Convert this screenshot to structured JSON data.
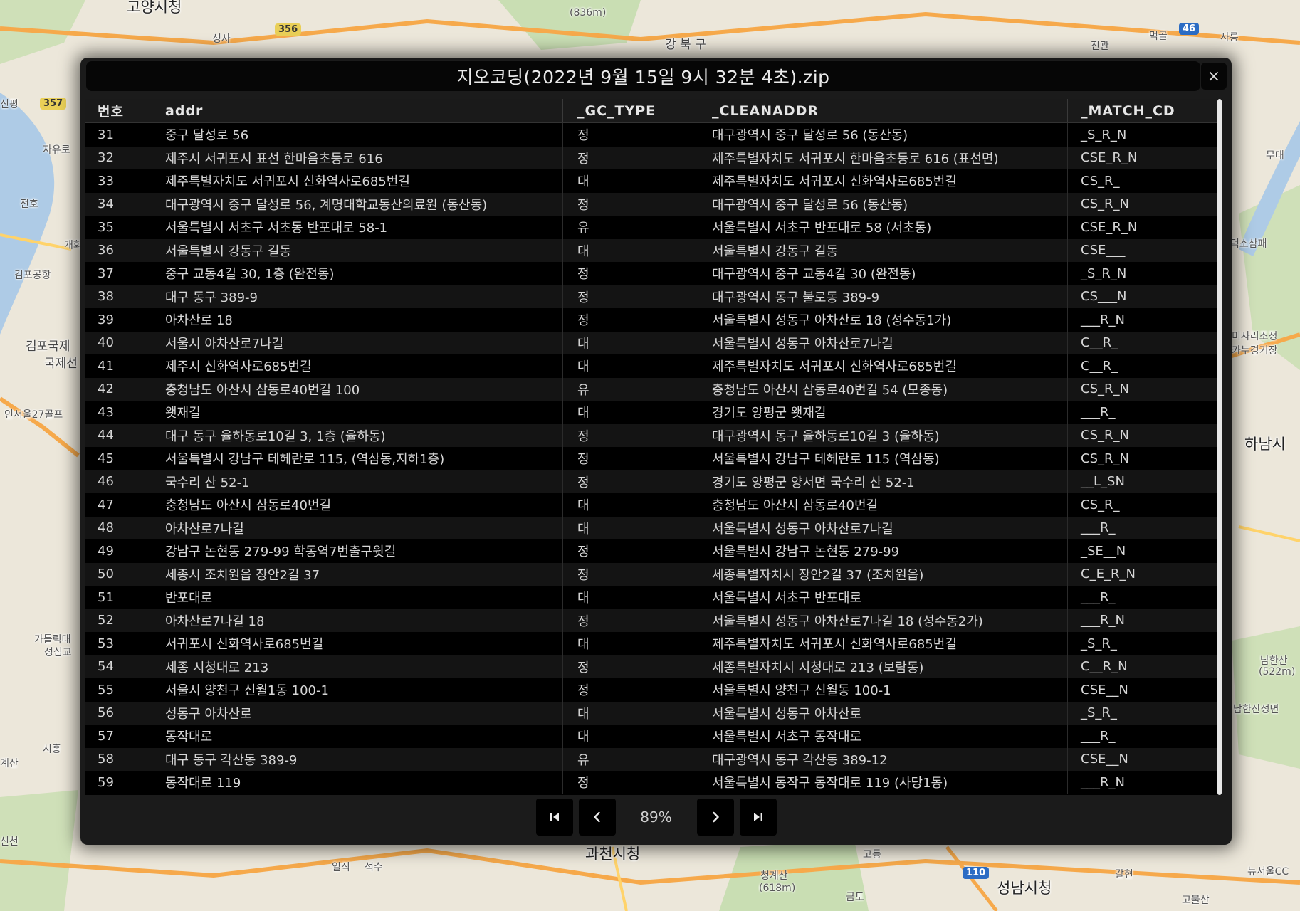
{
  "map": {
    "labels": [
      "고양시청",
      "성사",
      "(836m)",
      "강 북 구",
      "진관",
      "먹골",
      "사릉",
      "신평",
      "자유로",
      "전호",
      "김포공항",
      "김포국제",
      "국제선",
      "인서울27골프",
      "하남시",
      "덕소삼패",
      "미사리조정",
      "카누경기장",
      "무대",
      "가톨릭대",
      "성심교",
      "계산",
      "시흥",
      "과천시청",
      "청계산",
      "(618m)",
      "성남시청",
      "남한산",
      "(522m)",
      "남한산성면",
      "뉴서울CC",
      "고등",
      "갈현",
      "금토",
      "일직",
      "석수",
      "고불산",
      "개화",
      "신천"
    ],
    "shields": [
      "356",
      "357",
      "46",
      "110"
    ]
  },
  "dialog": {
    "title": "지오코딩(2022년 9월 15일 9시 32분 4초).zip",
    "close_label": "×"
  },
  "table": {
    "columns": [
      "번호",
      "addr",
      "_GC_TYPE",
      "_CLEANADDR",
      "_MATCH_CD"
    ],
    "rows": [
      [
        "31",
        "중구 달성로 56",
        "정",
        "대구광역시 중구 달성로 56 (동산동)",
        "_S_R_N"
      ],
      [
        "32",
        "제주시 서귀포시 표선 한마음초등로 616",
        "정",
        "제주특별자치도 서귀포시 한마음초등로 616 (표선면)",
        "CSE_R_N"
      ],
      [
        "33",
        "제주특별자치도 서귀포시 신화역사로685번길",
        "대",
        "제주특별자치도 서귀포시 신화역사로685번길",
        "CS_R_"
      ],
      [
        "34",
        "대구광역시 중구 달성로 56, 계명대학교동산의료원 (동산동)",
        "정",
        "대구광역시 중구 달성로 56 (동산동)",
        "CS_R_N"
      ],
      [
        "35",
        "서울특별시 서초구 서초동 반포대로 58-1",
        "유",
        "서울특별시 서초구 반포대로 58 (서초동)",
        "CSE_R_N"
      ],
      [
        "36",
        "서울특별시 강동구 길동",
        "대",
        "서울특별시 강동구 길동",
        "CSE___"
      ],
      [
        "37",
        "중구 교동4길 30, 1층 (완전동)",
        "정",
        "대구광역시 중구 교동4길 30 (완전동)",
        "_S_R_N"
      ],
      [
        "38",
        "대구 동구 389-9",
        "정",
        "대구광역시 동구 불로동 389-9",
        "CS___N"
      ],
      [
        "39",
        "아차산로 18",
        "정",
        "서울특별시 성동구 아차산로 18 (성수동1가)",
        "___R_N"
      ],
      [
        "40",
        "서울시 아차산로7나길",
        "대",
        "서울특별시 성동구 아차산로7나길",
        "C__R_"
      ],
      [
        "41",
        "제주시 신화역사로685번길",
        "대",
        "제주특별자치도 서귀포시 신화역사로685번길",
        "C__R_"
      ],
      [
        "42",
        "충청남도 아산시 삼동로40번길 100",
        "유",
        "충청남도 아산시 삼동로40번길 54 (모종동)",
        "CS_R_N"
      ],
      [
        "43",
        "왯재길",
        "대",
        "경기도 양평군 왯재길",
        "___R_"
      ],
      [
        "44",
        "대구 동구 율하동로10길 3, 1층 (율하동)",
        "정",
        "대구광역시 동구 율하동로10길 3 (율하동)",
        "CS_R_N"
      ],
      [
        "45",
        "서울특별시 강남구 테헤란로 115, (역삼동,지하1층)",
        "정",
        "서울특별시 강남구 테헤란로 115 (역삼동)",
        "CS_R_N"
      ],
      [
        "46",
        "국수리 산 52-1",
        "정",
        "경기도 양평군 양서면 국수리 산 52-1",
        "__L_SN"
      ],
      [
        "47",
        "충청남도 아산시 삼동로40번길",
        "대",
        "충청남도 아산시 삼동로40번길",
        "CS_R_"
      ],
      [
        "48",
        "아차산로7나길",
        "대",
        "서울특별시 성동구 아차산로7나길",
        "___R_"
      ],
      [
        "49",
        "강남구 논현동 279-99 학동역7번출구윗길",
        "정",
        "서울특별시 강남구 논현동 279-99",
        "_SE__N"
      ],
      [
        "50",
        "세종시 조치원읍 장안2길 37",
        "정",
        "세종특별자치시 장안2길 37 (조치원읍)",
        "C_E_R_N"
      ],
      [
        "51",
        "반포대로",
        "대",
        "서울특별시 서초구 반포대로",
        "___R_"
      ],
      [
        "52",
        "아차산로7나길 18",
        "정",
        "서울특별시 성동구 아차산로7나길 18 (성수동2가)",
        "___R_N"
      ],
      [
        "53",
        "서귀포시 신화역사로685번길",
        "대",
        "제주특별자치도 서귀포시 신화역사로685번길",
        "_S_R_"
      ],
      [
        "54",
        "세종 시청대로 213",
        "정",
        "세종특별자치시 시청대로 213 (보람동)",
        "C__R_N"
      ],
      [
        "55",
        "서울시 양천구 신월1동 100-1",
        "정",
        "서울특별시 양천구 신월동 100-1",
        "CSE__N"
      ],
      [
        "56",
        "성동구 아차산로",
        "대",
        "서울특별시 성동구 아차산로",
        "_S_R_"
      ],
      [
        "57",
        "동작대로",
        "대",
        "서울특별시 서초구 동작대로",
        "___R_"
      ],
      [
        "58",
        "대구 동구 각산동 389-9",
        "유",
        "대구광역시 동구 각산동 389-12",
        "CSE__N"
      ],
      [
        "59",
        "동작대로 119",
        "정",
        "서울특별시 동작구 동작대로 119 (사당1동)",
        "___R_N"
      ]
    ]
  },
  "pager": {
    "first_icon": "first-page-icon",
    "prev_icon": "chevron-left-icon",
    "zoom": "89%",
    "next_icon": "chevron-right-icon",
    "last_icon": "last-page-icon"
  }
}
